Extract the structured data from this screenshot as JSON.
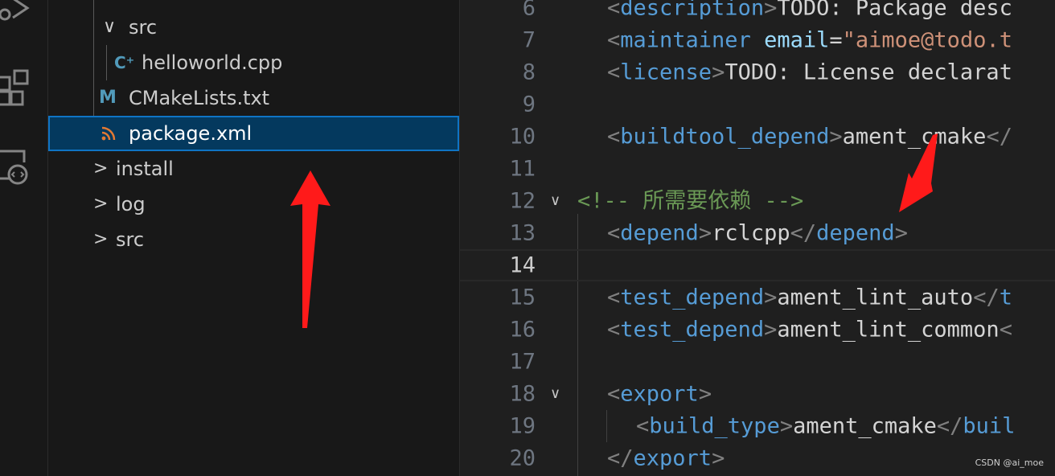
{
  "explorer": {
    "items": [
      {
        "label": "src",
        "chevron": "∨"
      },
      {
        "label": "helloworld.cpp",
        "icon": "C⁺"
      },
      {
        "label": "CMakeLists.txt",
        "icon": "M"
      },
      {
        "label": "package.xml",
        "icon": "rss-icon"
      },
      {
        "label": "install",
        "chevron": ">"
      },
      {
        "label": "log",
        "chevron": ">"
      },
      {
        "label": "src",
        "chevron": ">"
      }
    ]
  },
  "editor": {
    "lines": [
      {
        "n": "6",
        "t": [
          [
            "p",
            "<"
          ],
          [
            "t",
            "description"
          ],
          [
            "p",
            ">"
          ],
          [
            "x",
            "TODO: Package desc"
          ]
        ]
      },
      {
        "n": "7",
        "t": [
          [
            "p",
            "<"
          ],
          [
            "t",
            "maintainer"
          ],
          [
            "x",
            " "
          ],
          [
            "a",
            "email"
          ],
          [
            "x",
            "="
          ],
          [
            "s",
            "\"aimoe@todo.t"
          ]
        ]
      },
      {
        "n": "8",
        "t": [
          [
            "p",
            "<"
          ],
          [
            "t",
            "license"
          ],
          [
            "p",
            ">"
          ],
          [
            "x",
            "TODO: License declarat"
          ]
        ]
      },
      {
        "n": "9",
        "t": []
      },
      {
        "n": "10",
        "t": [
          [
            "p",
            "<"
          ],
          [
            "t",
            "buildtool_depend"
          ],
          [
            "p",
            ">"
          ],
          [
            "x",
            "ament_cmake"
          ],
          [
            "p",
            "</"
          ]
        ]
      },
      {
        "n": "11",
        "t": []
      },
      {
        "n": "12",
        "t": [
          [
            "c",
            "<!-- 所需要依赖 -->"
          ]
        ],
        "fold": "∨",
        "col": "comment"
      },
      {
        "n": "13",
        "t": [
          [
            "p",
            "<"
          ],
          [
            "t",
            "depend"
          ],
          [
            "p",
            ">"
          ],
          [
            "x",
            "rclcpp"
          ],
          [
            "p",
            "</"
          ],
          [
            "t",
            "depend"
          ],
          [
            "p",
            ">"
          ]
        ]
      },
      {
        "n": "14",
        "t": [],
        "current": true
      },
      {
        "n": "15",
        "t": [
          [
            "p",
            "<"
          ],
          [
            "t",
            "test_depend"
          ],
          [
            "p",
            ">"
          ],
          [
            "x",
            "ament_lint_auto"
          ],
          [
            "p",
            "</"
          ],
          [
            "t",
            "t"
          ]
        ]
      },
      {
        "n": "16",
        "t": [
          [
            "p",
            "<"
          ],
          [
            "t",
            "test_depend"
          ],
          [
            "p",
            ">"
          ],
          [
            "x",
            "ament_lint_common"
          ],
          [
            "p",
            "<"
          ]
        ]
      },
      {
        "n": "17",
        "t": []
      },
      {
        "n": "18",
        "t": [
          [
            "p",
            "<"
          ],
          [
            "t",
            "export"
          ],
          [
            "p",
            ">"
          ]
        ],
        "fold": "∨"
      },
      {
        "n": "19",
        "t": [
          [
            "p",
            "<"
          ],
          [
            "t",
            "build_type"
          ],
          [
            "p",
            ">"
          ],
          [
            "x",
            "ament_cmake"
          ],
          [
            "p",
            "</"
          ],
          [
            "t",
            "buil"
          ]
        ],
        "indent": 1
      },
      {
        "n": "20",
        "t": [
          [
            "p",
            "</"
          ],
          [
            "t",
            "export"
          ],
          [
            "p",
            ">"
          ]
        ]
      }
    ]
  },
  "watermark": "CSDN @ai_moe",
  "colors": {
    "arrow": "#ff0000",
    "selection": "#04395e",
    "selection_border": "#0f74c4",
    "tag": "#569cd6",
    "comment": "#6a9955"
  }
}
